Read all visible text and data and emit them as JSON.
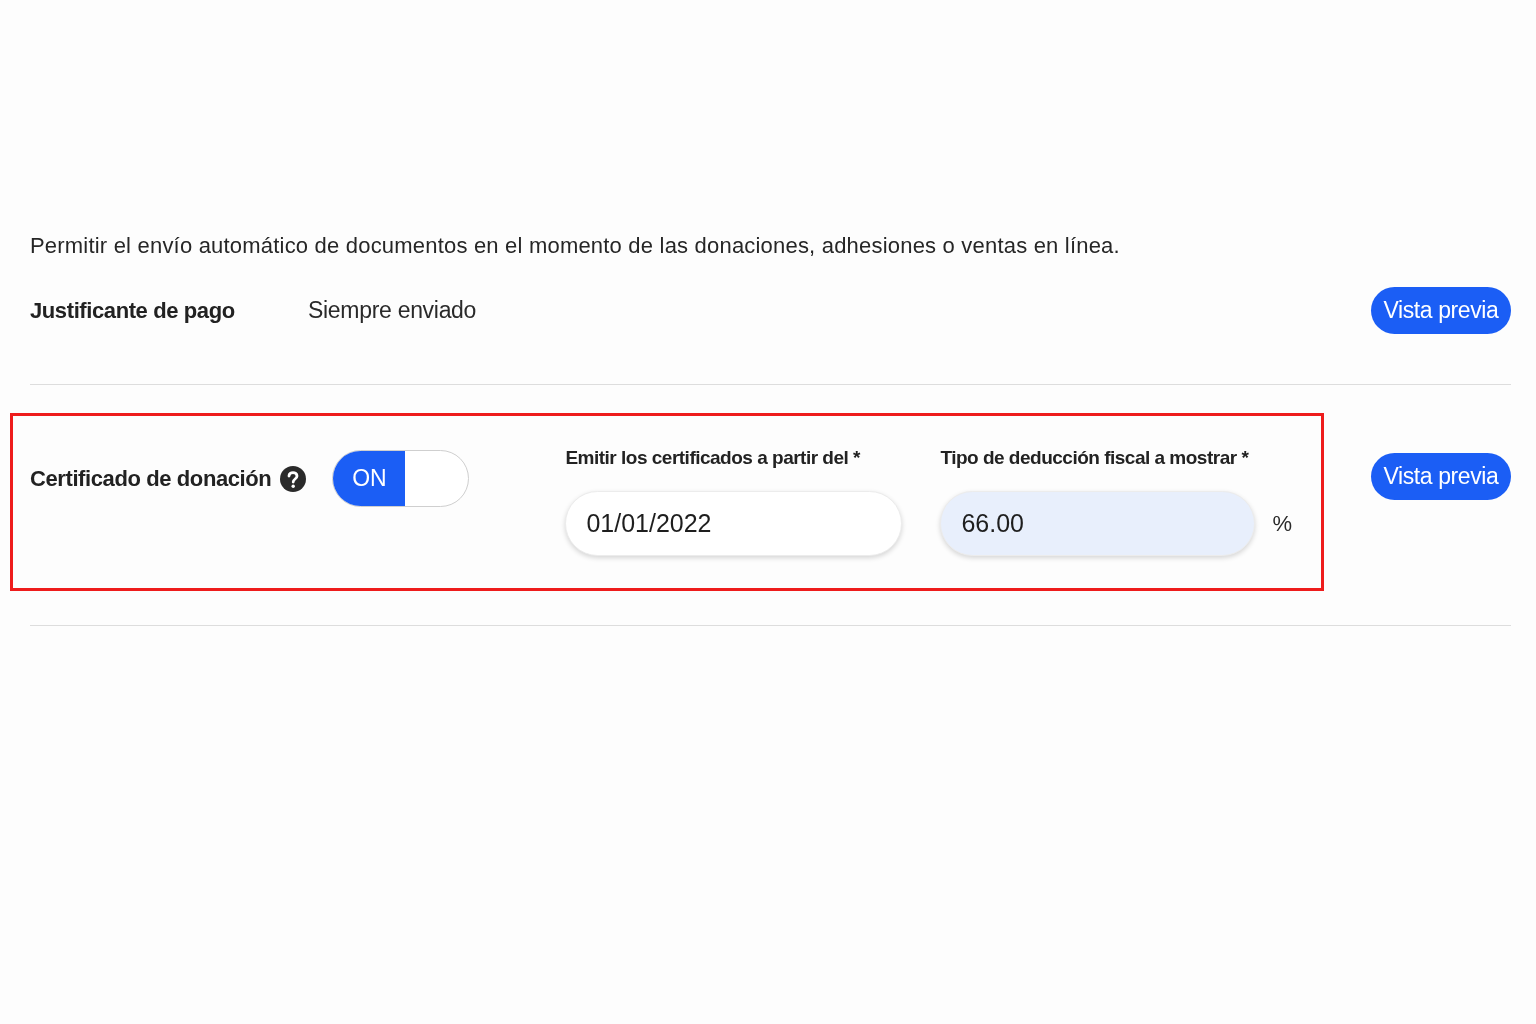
{
  "intro": "Permitir el envío automático de documentos en el momento de las donaciones, adhesiones o ventas en línea.",
  "settings": [
    {
      "kind": "fixed",
      "label": "Justificante de pago",
      "value": "Siempre enviado",
      "button": "Vista previa",
      "highlighted": false
    },
    {
      "kind": "toggle",
      "label": "Certificado de donación",
      "help": true,
      "toggle": {
        "label": "ON",
        "on": true
      },
      "fields": [
        {
          "label": "Emitir los certificados a partir del *",
          "value": "01/01/2022",
          "autofilled": false
        },
        {
          "label": "Tipo de deducción fiscal a mostrar *",
          "value": "66.00",
          "suffix": "%",
          "autofilled": true
        }
      ],
      "button": "Vista previa",
      "highlighted": true
    }
  ]
}
